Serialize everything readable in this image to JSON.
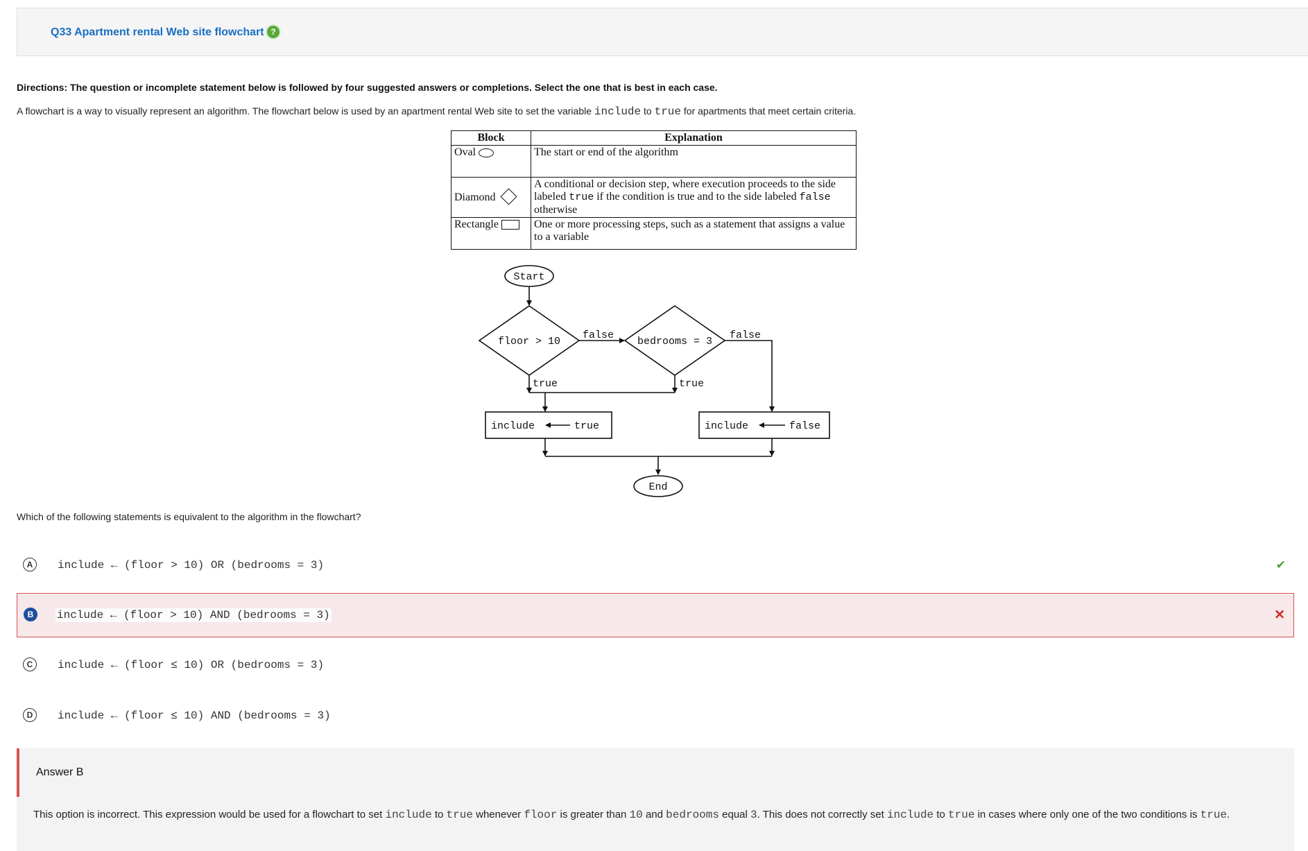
{
  "header": {
    "title": "Q33 Apartment rental Web site flowchart",
    "help_icon": "question-mark-icon"
  },
  "directions": "Directions: The question or incomplete statement below is followed by four suggested answers or completions. Select the one that is best in each case.",
  "intro": {
    "part1": "A flowchart is a way to visually represent an algorithm. The flowchart below is used by an apartment rental Web site to set the variable ",
    "code1": "include",
    "part2": " to ",
    "code2": "true",
    "part3": " for apartments that meet certain criteria."
  },
  "legend": {
    "header_block": "Block",
    "header_explanation": "Explanation",
    "rows": [
      {
        "block": "Oval",
        "explanation": "The start or end of the algorithm"
      },
      {
        "block": "Diamond",
        "explanation_part1": "A conditional or decision step, where execution proceeds to the side labeled ",
        "explanation_code1": "true",
        "explanation_part2": " if the condition is true and to the side labeled ",
        "explanation_code2": "false",
        "explanation_part3": " otherwise"
      },
      {
        "block": "Rectangle",
        "explanation": "One or more processing steps, such as a statement that assigns a value to a variable"
      }
    ]
  },
  "flowchart": {
    "start": "Start",
    "cond1": "floor > 10",
    "cond2": "bedrooms = 3",
    "false1": "false",
    "false2": "false",
    "true1": "true",
    "true2": "true",
    "box1_left": "include",
    "box1_right": "true",
    "box2_left": "include",
    "box2_right": "false",
    "end": "End"
  },
  "question": "Which of the following statements is equivalent to the algorithm in the flowchart?",
  "options": [
    {
      "letter": "A",
      "text": "include ← (floor > 10) OR (bedrooms = 3)",
      "status": "correct"
    },
    {
      "letter": "B",
      "text": "include ← (floor > 10) AND (bedrooms = 3)",
      "status": "selected-wrong"
    },
    {
      "letter": "C",
      "text": "include ← (floor ≤ 10) OR (bedrooms = 3)",
      "status": "none"
    },
    {
      "letter": "D",
      "text": "include ← (floor ≤ 10) AND (bedrooms = 3)",
      "status": "none"
    }
  ],
  "marks": {
    "correct": "✔",
    "wrong": "✕"
  },
  "answer": {
    "label": "Answer B",
    "t1": "This option is incorrect. This expression would be used for a flowchart to set ",
    "c1": "include",
    "t2": " to ",
    "c2": "true",
    "t3": " whenever ",
    "c3": "floor",
    "t4": " is greater than ",
    "c4": "10",
    "t5": " and ",
    "c5": "bedrooms",
    "t6": " equal ",
    "c6": "3",
    "t7": ". This does not correctly set ",
    "c7": "include",
    "t8": " to ",
    "c8": "true",
    "t9": " in cases where only one of the two conditions is ",
    "c9": "true",
    "t10": "."
  },
  "colors": {
    "title_link": "#1a6fc4",
    "help_icon": "#5aa83a",
    "correct": "#4a9f2e",
    "wrong": "#c9302c",
    "selected": "#1d4fa0",
    "wrong_bg": "#f7e8e9"
  }
}
